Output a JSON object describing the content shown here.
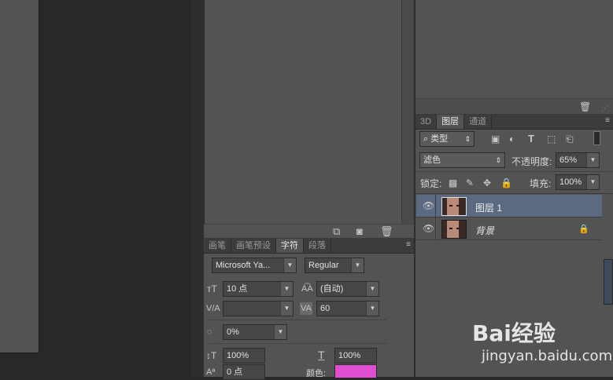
{
  "top_right_panel": {
    "trash_label": ""
  },
  "layers_panel": {
    "tabs": [
      "3D",
      "图层",
      "通道"
    ],
    "active_tab": "图层",
    "filter_kind": "类型",
    "blend_mode": "滤色",
    "opacity_label": "不透明度:",
    "opacity_value": "65%",
    "lock_label": "锁定:",
    "fill_label": "填充:",
    "fill_value": "100%",
    "layers": [
      {
        "name": "图层 1",
        "selected": true
      },
      {
        "name": "背景",
        "selected": false
      }
    ]
  },
  "char_panel": {
    "tabs": [
      "画笔",
      "画笔预设",
      "字符",
      "段落"
    ],
    "active_tab": "字符",
    "font_family": "Microsoft Ya...",
    "font_style": "Regular",
    "font_size": "10 点",
    "leading": "(自动)",
    "kerning": "",
    "tracking": "60",
    "tsume": "0%",
    "vertical_scale": "100%",
    "horizontal_scale": "100%",
    "baseline_shift": "0 点",
    "color_label": "颜色:",
    "color_value": "#e04fd2"
  },
  "watermark": {
    "brand": "Bai经验",
    "url": "jingyan.baidu.com"
  }
}
